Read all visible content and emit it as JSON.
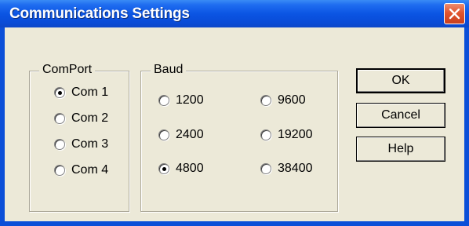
{
  "window": {
    "title": "Communications Settings",
    "close_icon": "close-x-icon"
  },
  "comport": {
    "title": "ComPort",
    "selected": "Com 1",
    "options": [
      {
        "label": "Com 1",
        "checked": true
      },
      {
        "label": "Com 2",
        "checked": false
      },
      {
        "label": "Com 3",
        "checked": false
      },
      {
        "label": "Com 4",
        "checked": false
      }
    ]
  },
  "baud": {
    "title": "Baud",
    "selected": "4800",
    "options": [
      {
        "label": "1200",
        "checked": false
      },
      {
        "label": "9600",
        "checked": false
      },
      {
        "label": "2400",
        "checked": false
      },
      {
        "label": "19200",
        "checked": false
      },
      {
        "label": "4800",
        "checked": true
      },
      {
        "label": "38400",
        "checked": false
      }
    ]
  },
  "buttons": {
    "ok": "OK",
    "cancel": "Cancel",
    "help": "Help"
  },
  "colors": {
    "titlebar": "#0b55e3",
    "client": "#ece9d8",
    "close": "#e1542e"
  }
}
